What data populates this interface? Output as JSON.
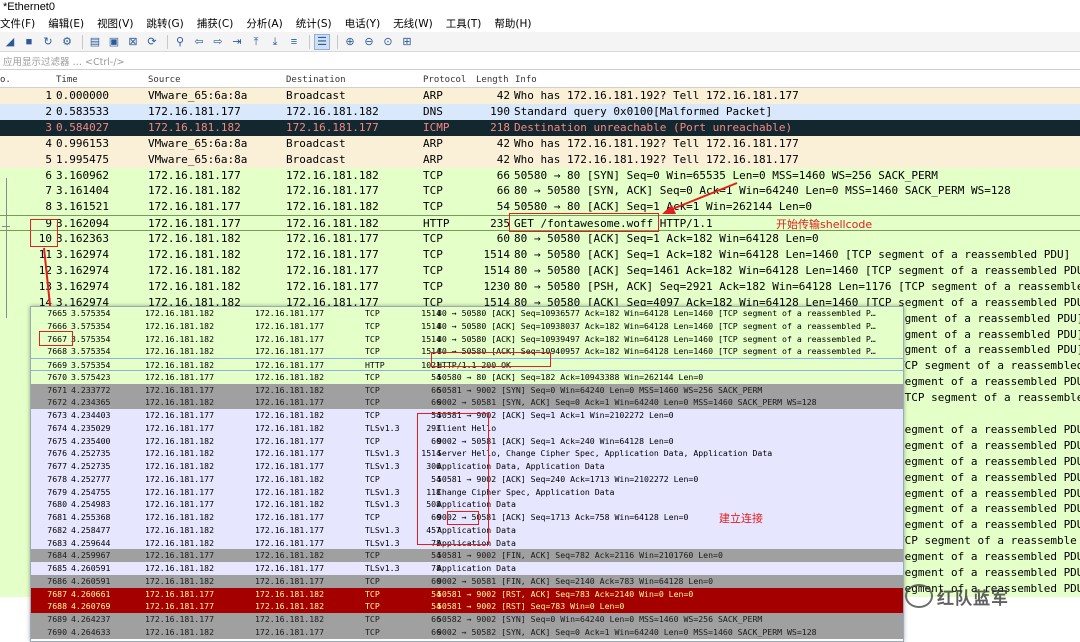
{
  "window": {
    "title": "*Ethernet0"
  },
  "menu": [
    "文件(F)",
    "编辑(E)",
    "视图(V)",
    "跳转(G)",
    "捕获(C)",
    "分析(A)",
    "统计(S)",
    "电话(Y)",
    "无线(W)",
    "工具(T)",
    "帮助(H)"
  ],
  "toolbar_icons": [
    "shark-fin-icon",
    "stop-icon",
    "restart-icon",
    "options-gear-icon",
    "open-file-icon",
    "save-file-icon",
    "close-file-icon",
    "reload-icon",
    "find-icon",
    "go-back-icon",
    "go-forward-icon",
    "go-to-packet-icon",
    "go-first-icon",
    "go-last-icon",
    "autoscroll-icon",
    "colorize-icon",
    "zoom-in-icon",
    "zoom-out-icon",
    "zoom-normal-icon",
    "resize-columns-icon"
  ],
  "filter": {
    "placeholder": "应用显示过滤器 … <Ctrl-/>"
  },
  "columns": {
    "no": "o.",
    "time": "Time",
    "source": "Source",
    "destination": "Destination",
    "protocol": "Protocol",
    "length": "Length",
    "info": "Info"
  },
  "packets": [
    {
      "no": "1",
      "time": "0.000000",
      "src": "VMware_65:6a:8a",
      "dst": "Broadcast",
      "proto": "ARP",
      "len": "42",
      "info": "Who has 172.16.181.192? Tell 172.16.181.177",
      "style": "arp"
    },
    {
      "no": "2",
      "time": "0.583533",
      "src": "172.16.181.177",
      "dst": "172.16.181.182",
      "proto": "DNS",
      "len": "190",
      "info": "Standard query 0x0100[Malformed Packet]",
      "style": "dns"
    },
    {
      "no": "3",
      "time": "0.584027",
      "src": "172.16.181.182",
      "dst": "172.16.181.177",
      "proto": "ICMP",
      "len": "218",
      "info": "Destination unreachable (Port unreachable)",
      "style": "icmp"
    },
    {
      "no": "4",
      "time": "0.996153",
      "src": "VMware_65:6a:8a",
      "dst": "Broadcast",
      "proto": "ARP",
      "len": "42",
      "info": "Who has 172.16.181.192? Tell 172.16.181.177",
      "style": "arp"
    },
    {
      "no": "5",
      "time": "1.995475",
      "src": "VMware_65:6a:8a",
      "dst": "Broadcast",
      "proto": "ARP",
      "len": "42",
      "info": "Who has 172.16.181.192? Tell 172.16.181.177",
      "style": "arp"
    },
    {
      "no": "6",
      "time": "3.160962",
      "src": "172.16.181.177",
      "dst": "172.16.181.182",
      "proto": "TCP",
      "len": "66",
      "info": "50580 → 80 [SYN] Seq=0 Win=65535 Len=0 MSS=1460 WS=256 SACK_PERM",
      "style": "tcp"
    },
    {
      "no": "7",
      "time": "3.161404",
      "src": "172.16.181.182",
      "dst": "172.16.181.177",
      "proto": "TCP",
      "len": "66",
      "info": "80 → 50580 [SYN, ACK] Seq=0 Ack=1 Win=64240 Len=0 MSS=1460 SACK_PERM WS=128",
      "style": "tcp"
    },
    {
      "no": "8",
      "time": "3.161521",
      "src": "172.16.181.177",
      "dst": "172.16.181.182",
      "proto": "TCP",
      "len": "54",
      "info": "50580 → 80 [ACK] Seq=1 Ack=1 Win=262144 Len=0",
      "style": "tcp"
    },
    {
      "no": "9",
      "time": "3.162094",
      "src": "172.16.181.177",
      "dst": "172.16.181.182",
      "proto": "HTTP",
      "len": "235",
      "info": "GET /fontawesome.woff HTTP/1.1",
      "style": "http"
    },
    {
      "no": "10",
      "time": "3.162363",
      "src": "172.16.181.182",
      "dst": "172.16.181.177",
      "proto": "TCP",
      "len": "60",
      "info": "80 → 50580 [ACK] Seq=1 Ack=182 Win=64128 Len=0",
      "style": "tcp"
    },
    {
      "no": "11",
      "time": "3.162974",
      "src": "172.16.181.182",
      "dst": "172.16.181.177",
      "proto": "TCP",
      "len": "1514",
      "info": "80 → 50580 [ACK] Seq=1 Ack=182 Win=64128 Len=1460 [TCP segment of a reassembled PDU]",
      "style": "tcp"
    },
    {
      "no": "12",
      "time": "3.162974",
      "src": "172.16.181.182",
      "dst": "172.16.181.177",
      "proto": "TCP",
      "len": "1514",
      "info": "80 → 50580 [ACK] Seq=1461 Ack=182 Win=64128 Len=1460 [TCP segment of a reassembled PDU]",
      "style": "tcp"
    },
    {
      "no": "13",
      "time": "3.162974",
      "src": "172.16.181.182",
      "dst": "172.16.181.177",
      "proto": "TCP",
      "len": "1230",
      "info": "80 → 50580 [PSH, ACK] Seq=2921 Ack=182 Win=64128 Len=1176 [TCP segment of a reassembled",
      "style": "tcp"
    },
    {
      "no": "14",
      "time": "3.162974",
      "src": "172.16.181.182",
      "dst": "172.16.181.177",
      "proto": "TCP",
      "len": "1514",
      "info": "80 → 50580 [ACK] Seq=4097 Ack=182 Win=64128 Len=1460 [TCP segment of a reassembled PDU]",
      "style": "tcp"
    },
    {
      "no": "",
      "time": "",
      "src": "",
      "dst": "",
      "proto": "",
      "len": "",
      "info": "egment of a reassembled PDU]",
      "style": "tcp"
    },
    {
      "no": "",
      "time": "",
      "src": "",
      "dst": "",
      "proto": "",
      "len": "",
      "info": "egment of a reassembled PDU]",
      "style": "tcp"
    },
    {
      "no": "",
      "time": "",
      "src": "",
      "dst": "",
      "proto": "",
      "len": "",
      "info": "egment of a reassembled PDU]",
      "style": "tcp"
    },
    {
      "no": "",
      "time": "",
      "src": "",
      "dst": "",
      "proto": "",
      "len": "",
      "info": "TCP segment of a reassembled",
      "style": "tcp"
    },
    {
      "no": "",
      "time": "",
      "src": "",
      "dst": "",
      "proto": "",
      "len": "",
      "info": "segment of a reassembled PDU",
      "style": "tcp"
    },
    {
      "no": "",
      "time": "",
      "src": "",
      "dst": "",
      "proto": "",
      "len": "",
      "info": "[TCP segment of a reassembled",
      "style": "tcp"
    },
    {
      "no": "",
      "time": "",
      "src": "",
      "dst": "",
      "proto": "",
      "len": "",
      "info": "",
      "style": "tcp"
    },
    {
      "no": "",
      "time": "",
      "src": "",
      "dst": "",
      "proto": "",
      "len": "",
      "info": "segment of a reassembled PDU",
      "style": "tcp"
    },
    {
      "no": "",
      "time": "",
      "src": "",
      "dst": "",
      "proto": "",
      "len": "",
      "info": "segment of a reassembled PDU",
      "style": "tcp"
    },
    {
      "no": "",
      "time": "",
      "src": "",
      "dst": "",
      "proto": "",
      "len": "",
      "info": "segment of a reassembled PDU",
      "style": "tcp"
    },
    {
      "no": "",
      "time": "",
      "src": "",
      "dst": "",
      "proto": "",
      "len": "",
      "info": "segment of a reassembled PDU",
      "style": "tcp"
    },
    {
      "no": "",
      "time": "",
      "src": "",
      "dst": "",
      "proto": "",
      "len": "",
      "info": "segment of a reassembled PDU",
      "style": "tcp"
    },
    {
      "no": "",
      "time": "",
      "src": "",
      "dst": "",
      "proto": "",
      "len": "",
      "info": "segment of a reassembled PDU",
      "style": "tcp"
    },
    {
      "no": "",
      "time": "",
      "src": "",
      "dst": "",
      "proto": "",
      "len": "",
      "info": "segment of a reassembled PDU",
      "style": "tcp"
    },
    {
      "no": "",
      "time": "",
      "src": "",
      "dst": "",
      "proto": "",
      "len": "",
      "info": "TCP segment of a reassemble",
      "style": "tcp"
    },
    {
      "no": "",
      "time": "",
      "src": "",
      "dst": "",
      "proto": "",
      "len": "",
      "info": "segment of a reassembled PDU",
      "style": "tcp"
    },
    {
      "no": "",
      "time": "",
      "src": "",
      "dst": "",
      "proto": "",
      "len": "",
      "info": "segment of a reassembled PDU",
      "style": "tcp"
    },
    {
      "no": "",
      "time": "",
      "src": "",
      "dst": "",
      "proto": "",
      "len": "",
      "info": "segment of a reassembled PDU",
      "style": "tcp"
    }
  ],
  "overlay_packets": [
    {
      "no": "7665",
      "time": "3.575354",
      "src": "172.16.181.182",
      "dst": "172.16.181.177",
      "proto": "TCP",
      "len": "1514",
      "info": "80 → 50580 [ACK] Seq=10936577 Ack=182 Win=64128 Len=1460 [TCP segment of a reassembled P…",
      "style": "tcp"
    },
    {
      "no": "7666",
      "time": "3.575354",
      "src": "172.16.181.182",
      "dst": "172.16.181.177",
      "proto": "TCP",
      "len": "1514",
      "info": "80 → 50580 [ACK] Seq=10938037 Ack=182 Win=64128 Len=1460 [TCP segment of a reassembled P…",
      "style": "tcp"
    },
    {
      "no": "7667",
      "time": "3.575354",
      "src": "172.16.181.182",
      "dst": "172.16.181.177",
      "proto": "TCP",
      "len": "1514",
      "info": "80 → 50580 [ACK] Seq=10939497 Ack=182 Win=64128 Len=1460 [TCP segment of a reassembled P…",
      "style": "tcp"
    },
    {
      "no": "7668",
      "time": "3.575354",
      "src": "172.16.181.182",
      "dst": "172.16.181.177",
      "proto": "TCP",
      "len": "1514",
      "info": "80 → 50580 [ACK] Seq=10940957 Ack=182 Win=64128 Len=1460 [TCP segment of a reassembled P…",
      "style": "tcp"
    },
    {
      "no": "7669",
      "time": "3.575354",
      "src": "172.16.181.182",
      "dst": "172.16.181.177",
      "proto": "HTTP",
      "len": "1021",
      "info": "HTTP/1.1 200 OK",
      "style": "http"
    },
    {
      "no": "7670",
      "time": "3.575423",
      "src": "172.16.181.177",
      "dst": "172.16.181.182",
      "proto": "TCP",
      "len": "54",
      "info": "50580 → 80 [ACK] Seq=182 Ack=10943388 Win=262144 Len=0",
      "style": "tcp"
    },
    {
      "no": "7671",
      "time": "4.233772",
      "src": "172.16.181.177",
      "dst": "172.16.181.182",
      "proto": "TCP",
      "len": "66",
      "info": "50581 → 9002 [SYN] Seq=0 Win=64240 Len=0 MSS=1460 WS=256 SACK_PERM",
      "style": "gray"
    },
    {
      "no": "7672",
      "time": "4.234365",
      "src": "172.16.181.182",
      "dst": "172.16.181.177",
      "proto": "TCP",
      "len": "66",
      "info": "9002 → 50581 [SYN, ACK] Seq=0 Ack=1 Win=64240 Len=0 MSS=1460 SACK_PERM WS=128",
      "style": "gray"
    },
    {
      "no": "7673",
      "time": "4.234403",
      "src": "172.16.181.177",
      "dst": "172.16.181.182",
      "proto": "TCP",
      "len": "54",
      "info": "50581 → 9002 [ACK] Seq=1 Ack=1 Win=2102272 Len=0",
      "style": "lav"
    },
    {
      "no": "7674",
      "time": "4.235029",
      "src": "172.16.181.177",
      "dst": "172.16.181.182",
      "proto": "TLSv1.3",
      "len": "293",
      "info": "Client Hello",
      "style": "lav"
    },
    {
      "no": "7675",
      "time": "4.235400",
      "src": "172.16.181.182",
      "dst": "172.16.181.177",
      "proto": "TCP",
      "len": "60",
      "info": "9002 → 50581 [ACK] Seq=1 Ack=240 Win=64128 Len=0",
      "style": "lav"
    },
    {
      "no": "7676",
      "time": "4.252735",
      "src": "172.16.181.182",
      "dst": "172.16.181.177",
      "proto": "TLSv1.3",
      "len": "1514",
      "info": "Server Hello, Change Cipher Spec, Application Data, Application Data",
      "style": "lav"
    },
    {
      "no": "7677",
      "time": "4.252735",
      "src": "172.16.181.182",
      "dst": "172.16.181.177",
      "proto": "TLSv1.3",
      "len": "306",
      "info": "Application Data, Application Data",
      "style": "lav"
    },
    {
      "no": "7678",
      "time": "4.252777",
      "src": "172.16.181.177",
      "dst": "172.16.181.182",
      "proto": "TCP",
      "len": "54",
      "info": "50581 → 9002 [ACK] Seq=240 Ack=1713 Win=2102272 Len=0",
      "style": "lav"
    },
    {
      "no": "7679",
      "time": "4.254755",
      "src": "172.16.181.177",
      "dst": "172.16.181.182",
      "proto": "TLSv1.3",
      "len": "118",
      "info": "Change Cipher Spec, Application Data",
      "style": "lav"
    },
    {
      "no": "7680",
      "time": "4.254983",
      "src": "172.16.181.177",
      "dst": "172.16.181.182",
      "proto": "TLSv1.3",
      "len": "508",
      "info": "Application Data",
      "style": "lav"
    },
    {
      "no": "7681",
      "time": "4.255368",
      "src": "172.16.181.182",
      "dst": "172.16.181.177",
      "proto": "TCP",
      "len": "60",
      "info": "9002 → 50581 [ACK] Seq=1713 Ack=758 Win=64128 Len=0",
      "style": "lav"
    },
    {
      "no": "7682",
      "time": "4.258477",
      "src": "172.16.181.182",
      "dst": "172.16.181.177",
      "proto": "TLSv1.3",
      "len": "457",
      "info": "Application Data",
      "style": "lav"
    },
    {
      "no": "7683",
      "time": "4.259644",
      "src": "172.16.181.182",
      "dst": "172.16.181.177",
      "proto": "TLSv1.3",
      "len": "78",
      "info": "Application Data",
      "style": "lav"
    },
    {
      "no": "7684",
      "time": "4.259967",
      "src": "172.16.181.177",
      "dst": "172.16.181.182",
      "proto": "TCP",
      "len": "54",
      "info": "50581 → 9002 [FIN, ACK] Seq=782 Ack=2116 Win=2101760 Len=0",
      "style": "gray"
    },
    {
      "no": "7685",
      "time": "4.260591",
      "src": "172.16.181.182",
      "dst": "172.16.181.177",
      "proto": "TLSv1.3",
      "len": "78",
      "info": "Application Data",
      "style": "lav"
    },
    {
      "no": "7686",
      "time": "4.260591",
      "src": "172.16.181.182",
      "dst": "172.16.181.177",
      "proto": "TCP",
      "len": "60",
      "info": "9002 → 50581 [FIN, ACK] Seq=2140 Ack=783 Win=64128 Len=0",
      "style": "gray"
    },
    {
      "no": "7687",
      "time": "4.260661",
      "src": "172.16.181.177",
      "dst": "172.16.181.182",
      "proto": "TCP",
      "len": "54",
      "info": "50581 → 9002 [RST, ACK] Seq=783 Ack=2140 Win=0 Len=0",
      "style": "red"
    },
    {
      "no": "7688",
      "time": "4.260769",
      "src": "172.16.181.177",
      "dst": "172.16.181.182",
      "proto": "TCP",
      "len": "54",
      "info": "50581 → 9002 [RST] Seq=783 Win=0 Len=0",
      "style": "red"
    },
    {
      "no": "7689",
      "time": "4.264237",
      "src": "172.16.181.177",
      "dst": "172.16.181.182",
      "proto": "TCP",
      "len": "66",
      "info": "50582 → 9002 [SYN] Seq=0 Win=64240 Len=0 MSS=1460 WS=256 SACK_PERM",
      "style": "gray"
    },
    {
      "no": "7690",
      "time": "4.264633",
      "src": "172.16.181.182",
      "dst": "172.16.181.177",
      "proto": "TCP",
      "len": "66",
      "info": "9002 → 50582 [SYN, ACK] Seq=0 Ack=1 Win=64240 Len=0 MSS=1460 SACK_PERM WS=128",
      "style": "gray"
    }
  ],
  "annotations": {
    "shellcode": "开始传输shellcode",
    "connect": "建立连接"
  },
  "watermark": {
    "text": "红队蓝军"
  },
  "colors": {
    "annotation": "#e02020",
    "tcp_row": "#e4ffc7",
    "arp_row": "#faf0d7",
    "dns_row": "#dae8fc",
    "icmp_row": "#12272e",
    "rst_row": "#a40000",
    "gray_row": "#a0a0a0",
    "tls_row": "#e7e6ff"
  }
}
